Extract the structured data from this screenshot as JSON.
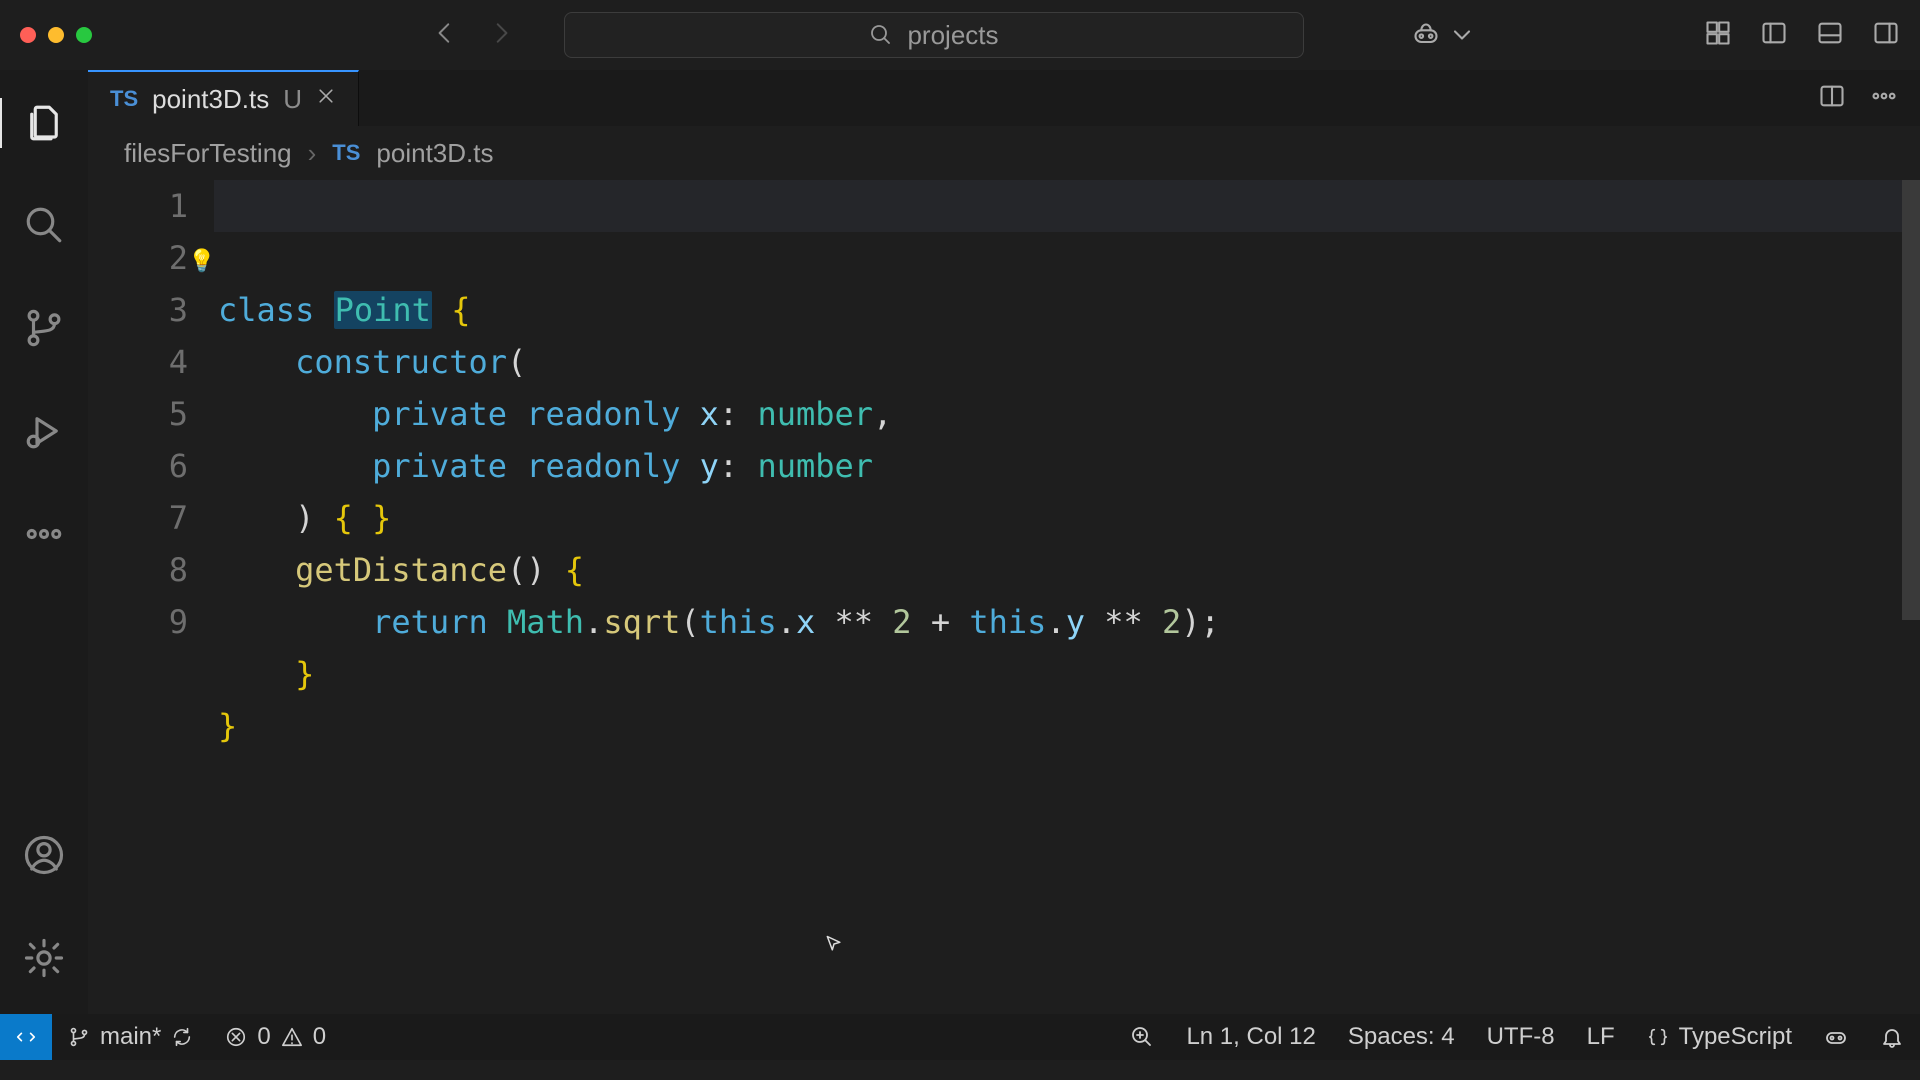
{
  "window": {
    "search_text": "projects"
  },
  "tab": {
    "filename": "point3D.ts",
    "lang_badge": "TS",
    "modified": "U"
  },
  "breadcrumb": {
    "folder": "filesForTesting",
    "file": "point3D.ts",
    "lang_badge": "TS"
  },
  "code": {
    "line_numbers": [
      "1",
      "2",
      "3",
      "4",
      "5",
      "6",
      "7",
      "8",
      "9"
    ],
    "tokens": {
      "kw_class": "class",
      "type_point": "Point",
      "brace_open": "{",
      "fn_ctor": "constructor",
      "paren_open": "(",
      "kw_private": "private",
      "kw_readonly": "readonly",
      "var_x": "x",
      "var_y": "y",
      "colon": ":",
      "type_number": "number",
      "comma": ",",
      "paren_close": ")",
      "brace_pair": "{ }",
      "fn_getdist": "getDistance",
      "parens": "()",
      "kw_return": "return",
      "obj_math": "Math",
      "dot": ".",
      "fn_sqrt": "sqrt",
      "kw_this": "this",
      "prop_x": "x",
      "prop_y": "y",
      "op_pow": "**",
      "num_2": "2",
      "op_plus": "+",
      "semi": ";",
      "brace_close": "}"
    }
  },
  "status": {
    "branch": "main*",
    "errors": "0",
    "warnings": "0",
    "cursor": "Ln 1, Col 12",
    "spaces": "Spaces: 4",
    "encoding": "UTF-8",
    "eol": "LF",
    "language": "TypeScript"
  }
}
